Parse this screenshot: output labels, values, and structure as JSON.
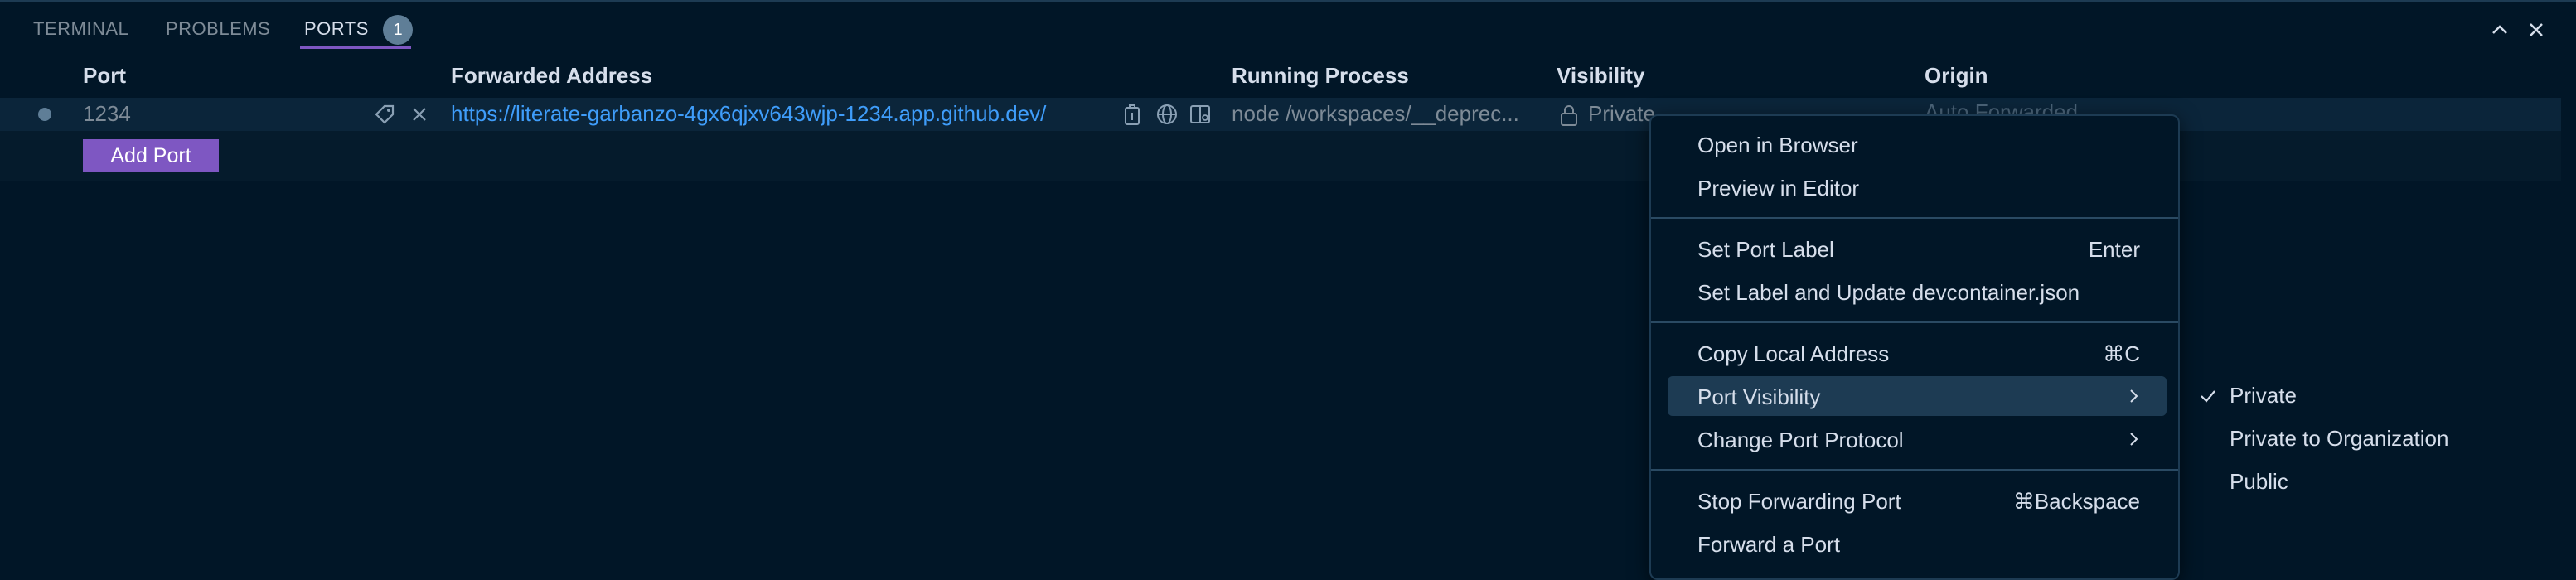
{
  "tabs": [
    {
      "label": "TERMINAL"
    },
    {
      "label": "PROBLEMS"
    },
    {
      "label": "PORTS",
      "badge": "1",
      "active": true
    }
  ],
  "table": {
    "headers": {
      "port": "Port",
      "address": "Forwarded Address",
      "process": "Running Process",
      "visibility": "Visibility",
      "origin": "Origin"
    },
    "row": {
      "port": "1234",
      "address": "https://literate-garbanzo-4gx6qjxv643wjp-1234.app.github.dev/",
      "process": "node /workspaces/__deprec...",
      "visibility": "Private",
      "origin": "Auto Forwarded"
    }
  },
  "add_port_label": "Add Port",
  "context_menu": {
    "items": [
      {
        "label": "Open in Browser"
      },
      {
        "label": "Preview in Editor"
      },
      {
        "label": "Set Port Label",
        "shortcut": "Enter"
      },
      {
        "label": "Set Label and Update devcontainer.json"
      },
      {
        "label": "Copy Local Address",
        "shortcut": "⌘C"
      },
      {
        "label": "Port Visibility",
        "submenu": true,
        "highlighted": true
      },
      {
        "label": "Change Port Protocol",
        "submenu": true
      },
      {
        "label": "Stop Forwarding Port",
        "shortcut": "⌘Backspace"
      },
      {
        "label": "Forward a Port"
      }
    ]
  },
  "visibility_submenu": {
    "items": [
      {
        "label": "Private",
        "checked": true
      },
      {
        "label": "Private to Organization"
      },
      {
        "label": "Public"
      }
    ]
  },
  "colors": {
    "background": "#011627",
    "accent": "#7e57c2",
    "link": "#3f9dfa",
    "row_bg": "#0b253a",
    "menu_highlight": "#1d3b53"
  }
}
